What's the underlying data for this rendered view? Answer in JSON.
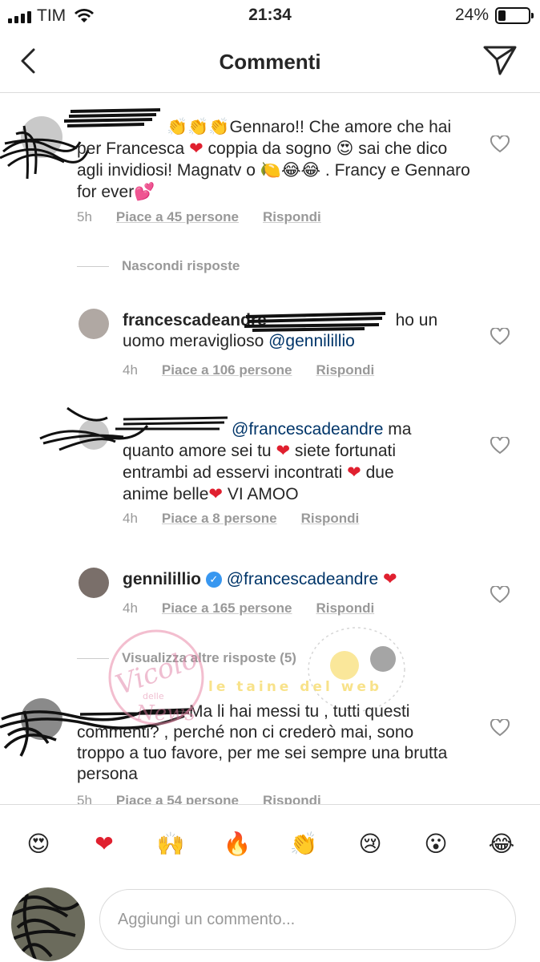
{
  "status_bar": {
    "carrier": "TIM",
    "time": "21:34",
    "battery": "24%",
    "battery_level": 0.24
  },
  "nav": {
    "title": "Commenti"
  },
  "comments": [
    {
      "username": "",
      "text": "Gennaro!! Che amore che hai per Francesca",
      "text2": "coppia da sogno",
      "text3": "sai che dico agli invidiosi! Magnatv o",
      "text4": ".",
      "text5": "Francy e Gennaro for ever",
      "time": "5h",
      "likes": "Piace a 45 persone",
      "reply": "Rispondi"
    },
    {
      "username": "francescadeandre",
      "text": "ho un uomo meraviglioso",
      "mention": "@gennilillio",
      "time": "4h",
      "likes": "Piace a 106 persone",
      "reply": "Rispondi"
    },
    {
      "mention": "@francescadeandre",
      "text": "ma quanto amore sei tu",
      "text2": "siete fortunati entrambi ad esservi incontrati",
      "text3": "due anime belle",
      "text4": "VI AMOO",
      "time": "4h",
      "likes": "Piace a 8 persone",
      "reply": "Rispondi"
    },
    {
      "username": "gennilillio",
      "mention": "@francescadeandre",
      "time": "4h",
      "likes": "Piace a 165 persone",
      "reply": "Rispondi"
    },
    {
      "text": "Ma li hai messi tu , tutti questi commenti? , perché non ci crederò mai, sono troppo a tuo favore, per me sei sempre una brutta persona",
      "time": "5h",
      "likes": "Piace a 54 persone",
      "reply": "Rispondi"
    }
  ],
  "hide_replies": "Nascondi risposte",
  "view_more_replies": "Visualizza altre risposte (5)",
  "watermark": {
    "left": "Vicolo delle News",
    "right": "le taine del web"
  },
  "emoji_bar": [
    "heart-eyes",
    "red-heart",
    "raised-hands",
    "fire",
    "clapping-hands",
    "crying-face",
    "surprised-face",
    "tears-of-joy"
  ],
  "input": {
    "placeholder": "Aggiungi un commento..."
  },
  "colors": {
    "mention": "#003569",
    "meta": "#999999",
    "heart": "#e0202f",
    "divider": "#dbdbdb"
  }
}
